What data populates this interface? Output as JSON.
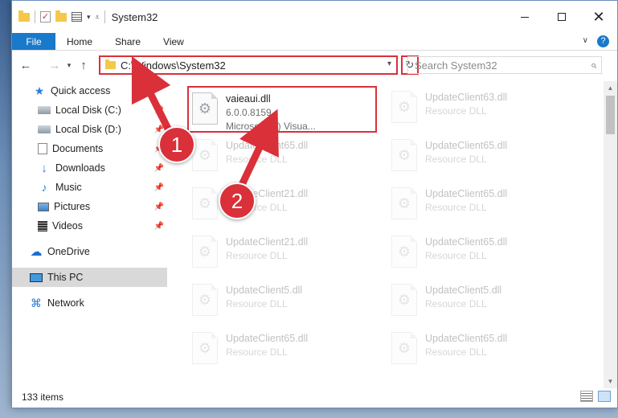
{
  "window": {
    "title": "System32",
    "controls": {
      "minimize": "—",
      "maximize": "☐",
      "close": "✕"
    }
  },
  "ribbon": {
    "tabs": [
      "File",
      "Home",
      "Share",
      "View"
    ],
    "help": "?"
  },
  "nav": {
    "back": "←",
    "forward": "→",
    "recent": "▾",
    "up": "↑",
    "address": "C:\\Windows\\System32",
    "address_dropdown": "▾",
    "refresh": "↻",
    "search_placeholder": "Search System32"
  },
  "sidebar": {
    "items": [
      {
        "label": "Quick access",
        "icon": "star-icon",
        "pinned": false
      },
      {
        "label": "Local Disk (C:)",
        "icon": "drive-icon",
        "pinned": true
      },
      {
        "label": "Local Disk (D:)",
        "icon": "drive-icon",
        "pinned": true
      },
      {
        "label": "Documents",
        "icon": "document-icon",
        "pinned": true
      },
      {
        "label": "Downloads",
        "icon": "download-icon",
        "pinned": true
      },
      {
        "label": "Music",
        "icon": "music-icon",
        "pinned": true
      },
      {
        "label": "Pictures",
        "icon": "pictures-icon",
        "pinned": true
      },
      {
        "label": "Videos",
        "icon": "videos-icon",
        "pinned": true
      },
      {
        "label": "OneDrive",
        "icon": "cloud-icon",
        "pinned": false
      },
      {
        "label": "This PC",
        "icon": "computer-icon",
        "pinned": false,
        "selected": true
      },
      {
        "label": "Network",
        "icon": "network-icon",
        "pinned": false
      }
    ]
  },
  "files": {
    "highlighted": {
      "name": "vaieaui.dll",
      "version": "6.0.0.8159",
      "description": "Microsoft (R) Visua..."
    },
    "left_column": [
      {
        "name": "UpdateClient65.dll",
        "type": "Resource DLL"
      },
      {
        "name": "UpdateClient21.dll",
        "type": "Resource DLL"
      },
      {
        "name": "UpdateClient21.dll",
        "type": "Resource DLL"
      },
      {
        "name": "UpdateClient5.dll",
        "type": "Resource DLL"
      },
      {
        "name": "UpdateClient65.dll",
        "type": "Resource DLL"
      }
    ],
    "right_column": [
      {
        "name": "UpdateClient63.dll",
        "type": "Resource DLL"
      },
      {
        "name": "UpdateClient65.dll",
        "type": "Resource DLL"
      },
      {
        "name": "UpdateClient65.dll",
        "type": "Resource DLL"
      },
      {
        "name": "UpdateClient65.dll",
        "type": "Resource DLL"
      },
      {
        "name": "UpdateClient5.dll",
        "type": "Resource DLL"
      },
      {
        "name": "UpdateClient65.dll",
        "type": "Resource DLL"
      }
    ]
  },
  "status": {
    "item_count": "133 items"
  },
  "annotations": {
    "step1": "1",
    "step2": "2",
    "accent_color": "#d9303a"
  }
}
